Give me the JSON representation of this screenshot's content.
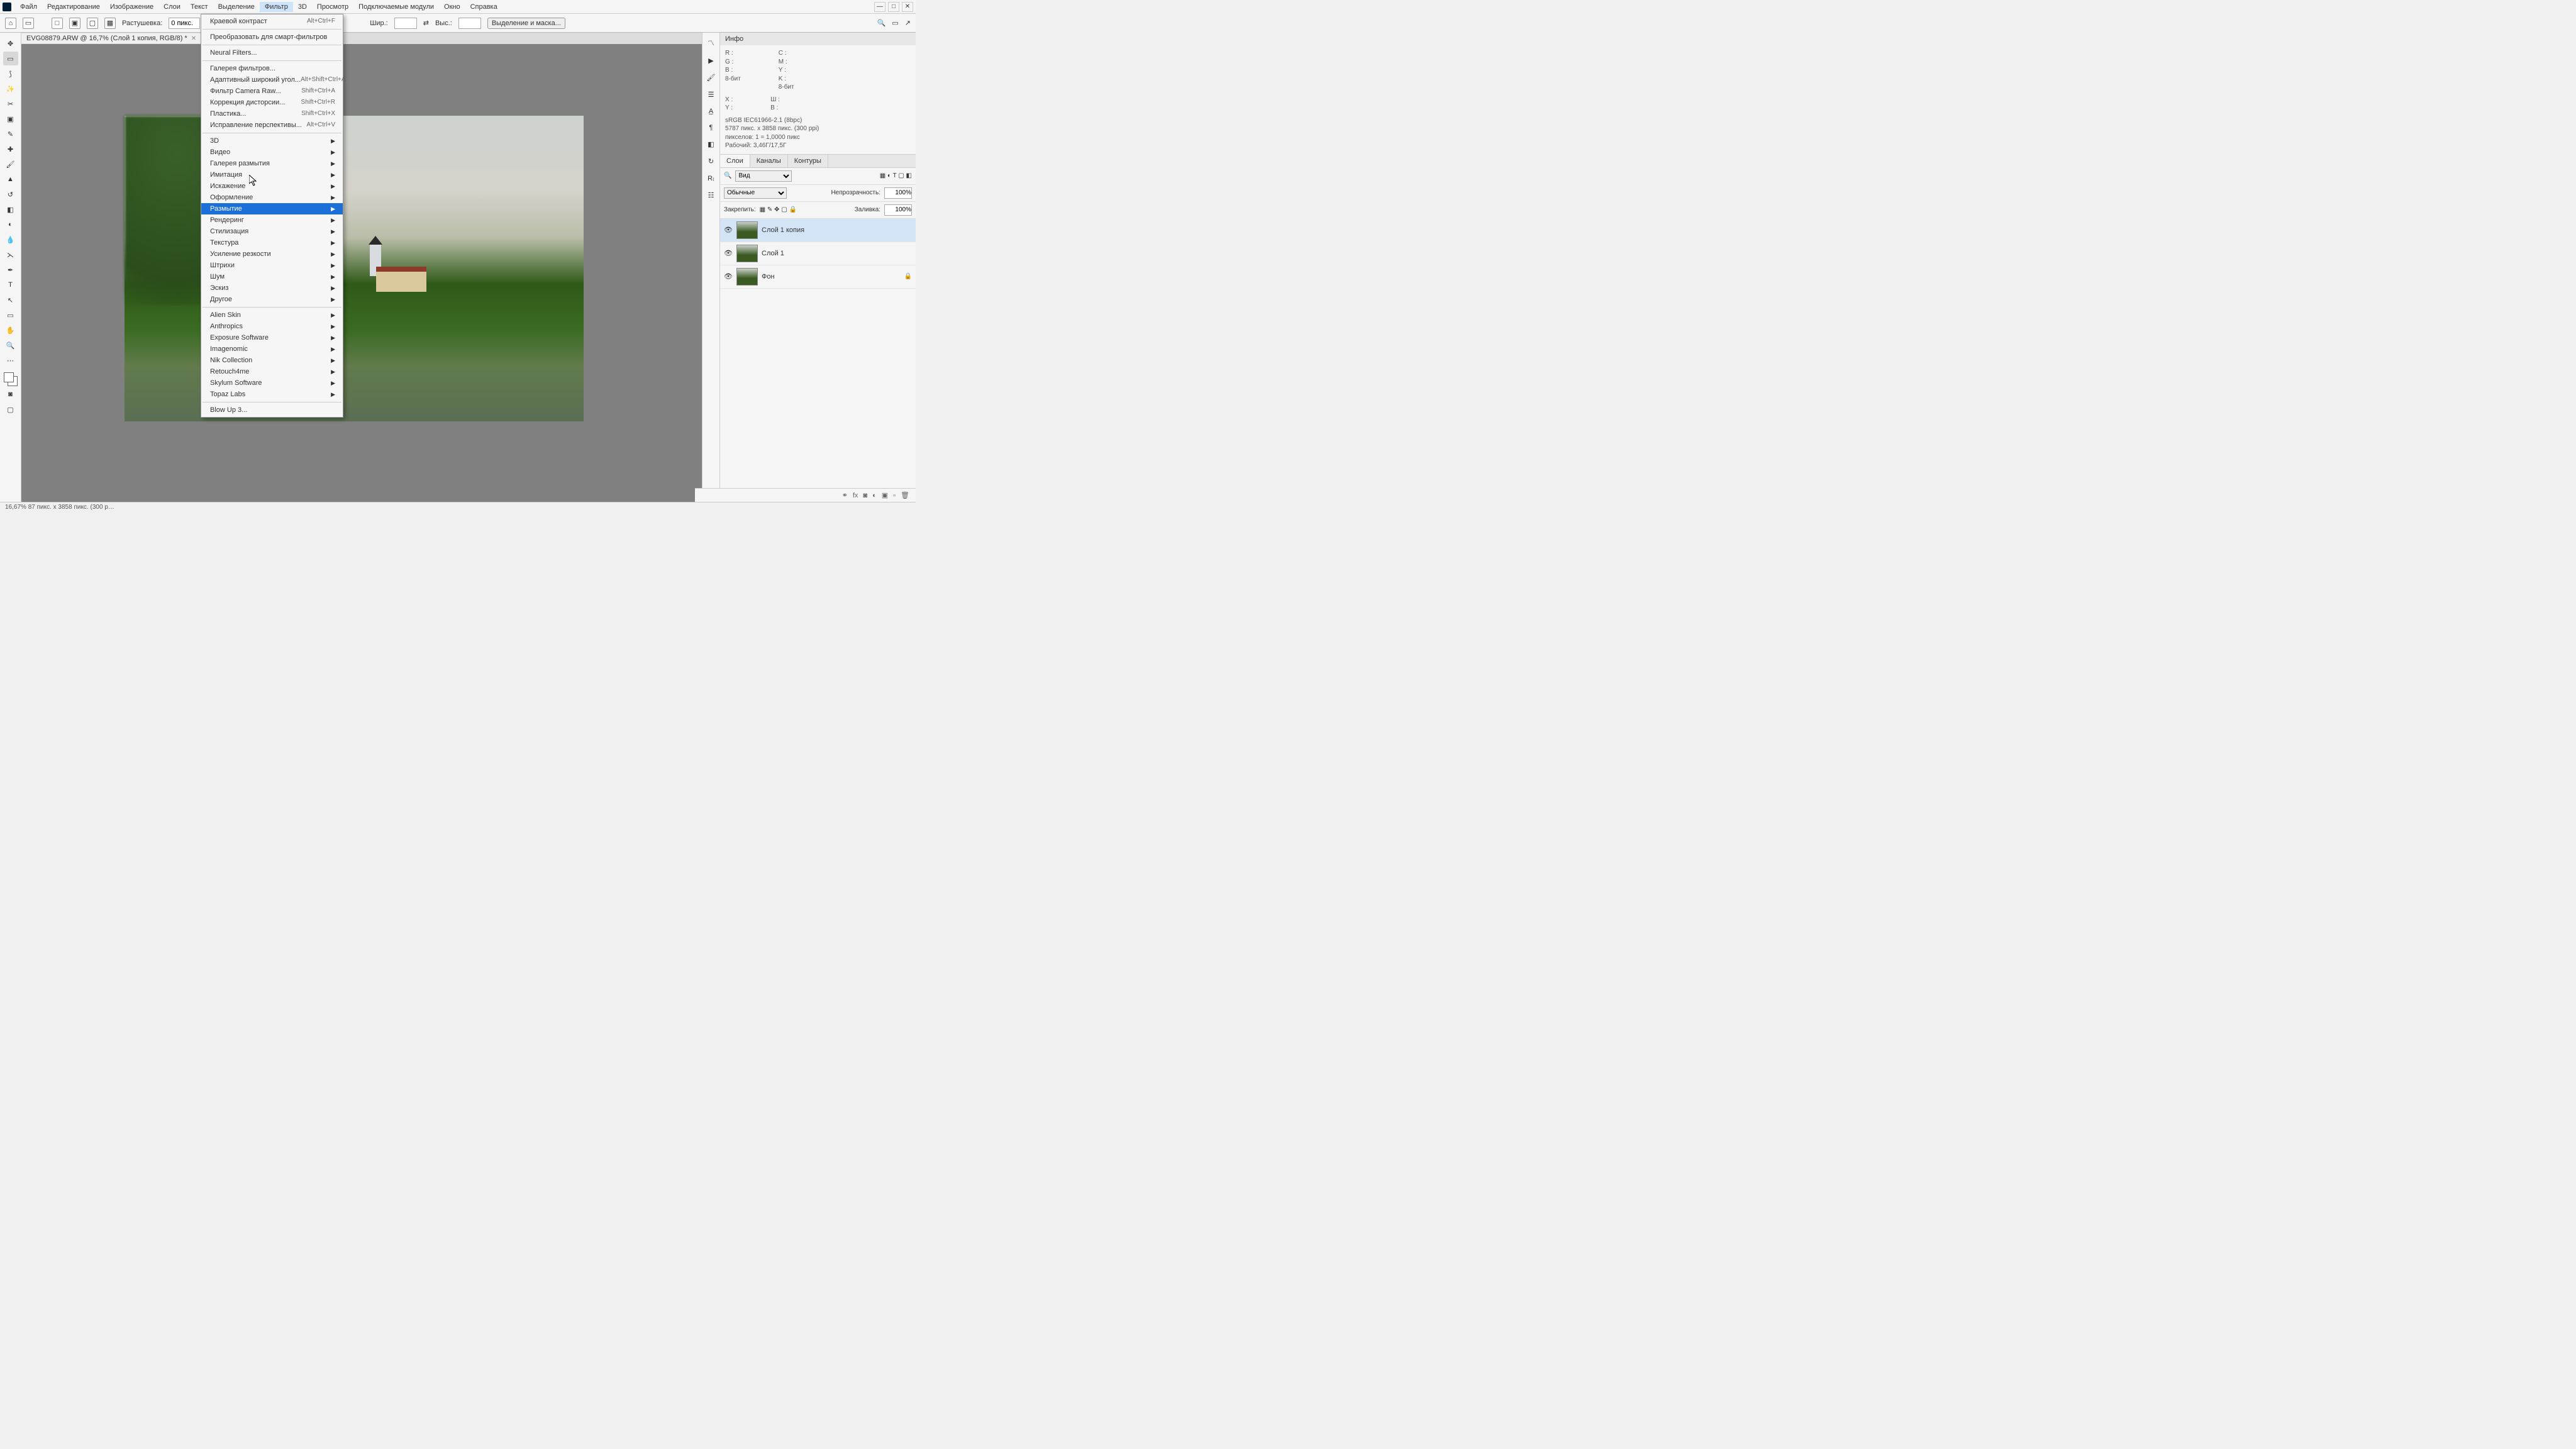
{
  "menubar": {
    "items": [
      "Файл",
      "Редактирование",
      "Изображение",
      "Слои",
      "Текст",
      "Выделение",
      "Фильтр",
      "3D",
      "Просмотр",
      "Подключаемые модули",
      "Окно",
      "Справка"
    ],
    "active_index": 6
  },
  "options": {
    "feather_label": "Растушевка:",
    "feather_value": "0 пикс.",
    "width_label": "Шир.:",
    "height_label": "Выс.:",
    "mask_btn": "Выделение и маска..."
  },
  "document": {
    "tab_title": "EVG08879.ARW @ 16,7% (Слой 1 копия, RGB/8) *"
  },
  "dropdown": {
    "group1": [
      {
        "label": "Краевой контраст",
        "shortcut": "Alt+Ctrl+F"
      }
    ],
    "group2": [
      {
        "label": "Преобразовать для смарт-фильтров"
      }
    ],
    "group3": [
      {
        "label": "Neural Filters..."
      }
    ],
    "group4": [
      {
        "label": "Галерея фильтров..."
      },
      {
        "label": "Адаптивный широкий угол...",
        "shortcut": "Alt+Shift+Ctrl+A"
      },
      {
        "label": "Фильтр Camera Raw...",
        "shortcut": "Shift+Ctrl+A"
      },
      {
        "label": "Коррекция дисторсии...",
        "shortcut": "Shift+Ctrl+R"
      },
      {
        "label": "Пластика...",
        "shortcut": "Shift+Ctrl+X"
      },
      {
        "label": "Исправление перспективы...",
        "shortcut": "Alt+Ctrl+V"
      }
    ],
    "group5": [
      {
        "label": "3D",
        "sub": true
      },
      {
        "label": "Видео",
        "sub": true
      },
      {
        "label": "Галерея размытия",
        "sub": true
      },
      {
        "label": "Имитация",
        "sub": true
      },
      {
        "label": "Искажение",
        "sub": true
      },
      {
        "label": "Оформление",
        "sub": true
      },
      {
        "label": "Размытие",
        "sub": true,
        "hl": true
      },
      {
        "label": "Рендеринг",
        "sub": true
      },
      {
        "label": "Стилизация",
        "sub": true
      },
      {
        "label": "Текстура",
        "sub": true
      },
      {
        "label": "Усиление резкости",
        "sub": true
      },
      {
        "label": "Штрихи",
        "sub": true
      },
      {
        "label": "Шум",
        "sub": true
      },
      {
        "label": "Эскиз",
        "sub": true
      },
      {
        "label": "Другое",
        "sub": true
      }
    ],
    "group6": [
      {
        "label": "Alien Skin",
        "sub": true
      },
      {
        "label": "Anthropics",
        "sub": true
      },
      {
        "label": "Exposure Software",
        "sub": true
      },
      {
        "label": "Imagenomic",
        "sub": true
      },
      {
        "label": "Nik Collection",
        "sub": true
      },
      {
        "label": "Retouch4me",
        "sub": true
      },
      {
        "label": "Skylum Software",
        "sub": true
      },
      {
        "label": "Topaz Labs",
        "sub": true
      }
    ],
    "group7": [
      {
        "label": "Blow Up 3..."
      }
    ]
  },
  "info_panel": {
    "title": "Инфо",
    "rgb": {
      "R": "R :",
      "G": "G :",
      "B": "B :"
    },
    "cmyk": {
      "C": "C :",
      "M": "M :",
      "Y": "Y :",
      "K": "K :"
    },
    "bits1": "8-бит",
    "bits2": "8-бит",
    "xy": {
      "X": "X :",
      "Y": "Y :"
    },
    "wh": {
      "W": "Ш :",
      "H": "В :"
    },
    "profile": "sRGB IEC61966-2.1 (8bpc)",
    "dims": "5787 пикс. x 3858 пикс. (300 ppi)",
    "pixels": "пикселов: 1 = 1,0000 пикс",
    "work": "Рабочий: 3,46Г/17,5Г"
  },
  "layers_panel": {
    "tabs": [
      "Слои",
      "Каналы",
      "Контуры"
    ],
    "kind_label": "Вид",
    "blend": "Обычные",
    "opacity_label": "Непрозрачность:",
    "opacity_value": "100%",
    "lock_label": "Закрепить:",
    "fill_label": "Заливка:",
    "fill_value": "100%",
    "items": [
      {
        "name": "Слой 1 копия",
        "sel": true
      },
      {
        "name": "Слой 1"
      },
      {
        "name": "Фон",
        "locked": true
      }
    ]
  },
  "status": "16,67% 87 пикс. x 3858 пикс. (300 p…"
}
